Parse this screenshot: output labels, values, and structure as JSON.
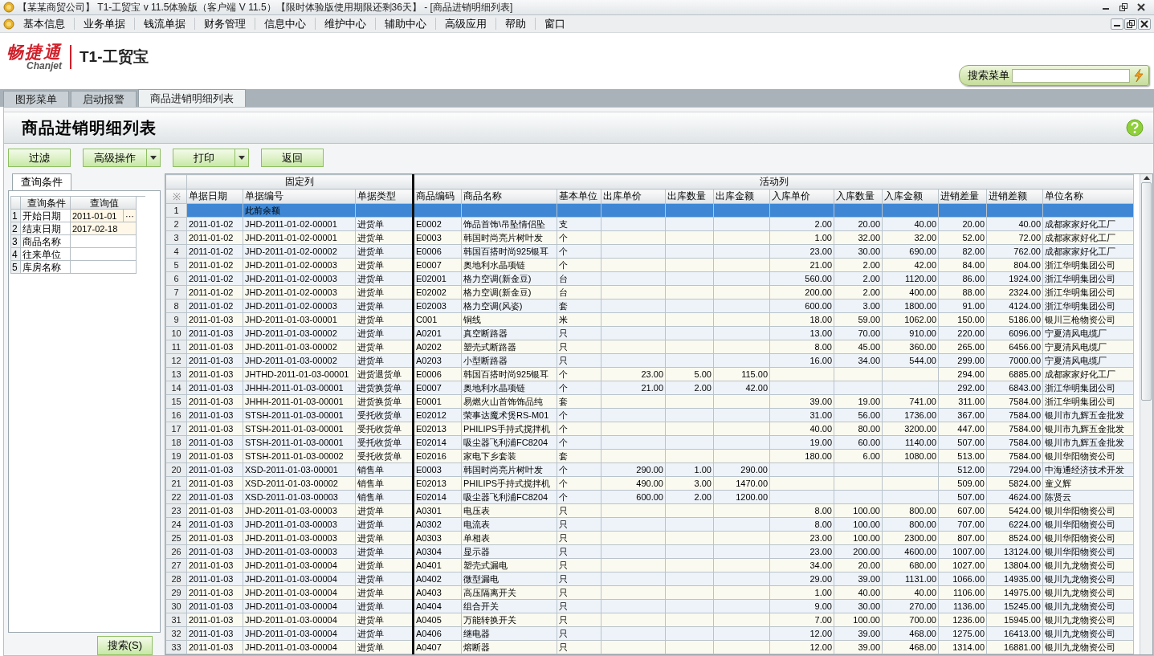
{
  "window": {
    "title": "【某某商贸公司】 T1-工贸宝 v 11.5体验版（客户端 V 11.5）【限时体验版使用期限还剩36天】 - [商品进销明细列表]"
  },
  "menu": [
    "基本信息",
    "业务单据",
    "钱流单据",
    "财务管理",
    "信息中心",
    "维护中心",
    "辅助中心",
    "高级应用",
    "帮助",
    "窗口"
  ],
  "logo": {
    "brand": "畅捷通",
    "brand_en": "Chanjet",
    "product": "T1-工贸宝"
  },
  "menu_search": {
    "label": "搜索菜单"
  },
  "tabs": [
    {
      "label": "图形菜单",
      "selected": false
    },
    {
      "label": "启动报警",
      "selected": false
    },
    {
      "label": "商品进销明细列表",
      "selected": true
    }
  ],
  "page_title": "商品进销明细列表",
  "toolbar": [
    {
      "label": "过滤",
      "dropdown": false
    },
    {
      "label": "高级操作",
      "dropdown": true
    },
    {
      "label": "打印",
      "dropdown": true
    },
    {
      "label": "返回",
      "dropdown": false
    }
  ],
  "query_panel": {
    "tab": "查询条件",
    "columns": [
      "查询条件",
      "查询值"
    ],
    "rows": [
      {
        "no": "1",
        "name": "开始日期",
        "value": "2011-01-01",
        "button": "···"
      },
      {
        "no": "2",
        "name": "结束日期",
        "value": "2017-02-18"
      },
      {
        "no": "3",
        "name": "商品名称"
      },
      {
        "no": "4",
        "name": "往来单位"
      },
      {
        "no": "5",
        "name": "库房名称"
      }
    ],
    "search_button": "搜索(S)"
  },
  "table": {
    "corner": "※",
    "groups": [
      {
        "label": "固定列",
        "columns": [
          "单据日期",
          "单据编号",
          "单据类型"
        ]
      },
      {
        "label": "活动列",
        "columns": [
          "商品编码",
          "商品名称",
          "基本单位",
          "出库单价",
          "出库数量",
          "出库金额",
          "入库单价",
          "入库数量",
          "入库金额",
          "进销差量",
          "进销差额",
          "单位名称"
        ]
      }
    ],
    "rows": [
      {
        "no": "1",
        "selected": true,
        "kind": "balance",
        "doc_no": "此前余额"
      },
      {
        "no": "2",
        "selected": false,
        "kind": "in",
        "date": "2011-01-02",
        "doc_no": "JHD-2011-01-02-00001",
        "doc_type": "进货单",
        "code": "E0002",
        "name": "饰品首饰\\吊坠情侣坠",
        "unit": "支",
        "price": "2.00",
        "qty": "20.00",
        "amount": "40.00",
        "diff_qty": "20.00",
        "diff_amount": "40.00",
        "partner": "成都家家好化工厂"
      },
      {
        "no": "3",
        "selected": false,
        "kind": "in",
        "date": "2011-01-02",
        "doc_no": "JHD-2011-01-02-00001",
        "doc_type": "进货单",
        "code": "E0003",
        "name": "韩国时尚亮片树叶发",
        "unit": "个",
        "price": "1.00",
        "qty": "32.00",
        "amount": "32.00",
        "diff_qty": "52.00",
        "diff_amount": "72.00",
        "partner": "成都家家好化工厂"
      },
      {
        "no": "4",
        "selected": false,
        "kind": "in",
        "date": "2011-01-02",
        "doc_no": "JHD-2011-01-02-00002",
        "doc_type": "进货单",
        "code": "E0006",
        "name": "韩国百搭时尚925银耳",
        "unit": "个",
        "price": "23.00",
        "qty": "30.00",
        "amount": "690.00",
        "diff_qty": "82.00",
        "diff_amount": "762.00",
        "partner": "成都家家好化工厂"
      },
      {
        "no": "5",
        "selected": false,
        "kind": "in",
        "date": "2011-01-02",
        "doc_no": "JHD-2011-01-02-00003",
        "doc_type": "进货单",
        "code": "E0007",
        "name": "奥地利水晶项链",
        "unit": "个",
        "price": "21.00",
        "qty": "2.00",
        "amount": "42.00",
        "diff_qty": "84.00",
        "diff_amount": "804.00",
        "partner": "浙江华明集团公司"
      },
      {
        "no": "6",
        "selected": false,
        "kind": "in",
        "date": "2011-01-02",
        "doc_no": "JHD-2011-01-02-00003",
        "doc_type": "进货单",
        "code": "E02001",
        "name": "格力空调(新金豆)",
        "unit": "台",
        "price": "560.00",
        "qty": "2.00",
        "amount": "1120.00",
        "diff_qty": "86.00",
        "diff_amount": "1924.00",
        "partner": "浙江华明集团公司"
      },
      {
        "no": "7",
        "selected": false,
        "kind": "in",
        "date": "2011-01-02",
        "doc_no": "JHD-2011-01-02-00003",
        "doc_type": "进货单",
        "code": "E02002",
        "name": "格力空调(新金豆)",
        "unit": "台",
        "price": "200.00",
        "qty": "2.00",
        "amount": "400.00",
        "diff_qty": "88.00",
        "diff_amount": "2324.00",
        "partner": "浙江华明集团公司"
      },
      {
        "no": "8",
        "selected": false,
        "kind": "in",
        "date": "2011-01-02",
        "doc_no": "JHD-2011-01-02-00003",
        "doc_type": "进货单",
        "code": "E02003",
        "name": "格力空调(风姿)",
        "unit": "套",
        "price": "600.00",
        "qty": "3.00",
        "amount": "1800.00",
        "diff_qty": "91.00",
        "diff_amount": "4124.00",
        "partner": "浙江华明集团公司"
      },
      {
        "no": "9",
        "selected": false,
        "kind": "in",
        "date": "2011-01-03",
        "doc_no": "JHD-2011-01-03-00001",
        "doc_type": "进货单",
        "code": "C001",
        "name": "铜线",
        "unit": "米",
        "price": "18.00",
        "qty": "59.00",
        "amount": "1062.00",
        "diff_qty": "150.00",
        "diff_amount": "5186.00",
        "partner": "银川三枪物资公司"
      },
      {
        "no": "10",
        "selected": false,
        "kind": "in",
        "date": "2011-01-03",
        "doc_no": "JHD-2011-01-03-00002",
        "doc_type": "进货单",
        "code": "A0201",
        "name": "真空断路器",
        "unit": "只",
        "price": "13.00",
        "qty": "70.00",
        "amount": "910.00",
        "diff_qty": "220.00",
        "diff_amount": "6096.00",
        "partner": "宁夏清风电缆厂"
      },
      {
        "no": "11",
        "selected": false,
        "kind": "in",
        "date": "2011-01-03",
        "doc_no": "JHD-2011-01-03-00002",
        "doc_type": "进货单",
        "code": "A0202",
        "name": "塑壳式断路器",
        "unit": "只",
        "price": "8.00",
        "qty": "45.00",
        "amount": "360.00",
        "diff_qty": "265.00",
        "diff_amount": "6456.00",
        "partner": "宁夏清风电缆厂"
      },
      {
        "no": "12",
        "selected": false,
        "kind": "in",
        "date": "2011-01-03",
        "doc_no": "JHD-2011-01-03-00002",
        "doc_type": "进货单",
        "code": "A0203",
        "name": "小型断路器",
        "unit": "只",
        "price": "16.00",
        "qty": "34.00",
        "amount": "544.00",
        "diff_qty": "299.00",
        "diff_amount": "7000.00",
        "partner": "宁夏清风电缆厂"
      },
      {
        "no": "13",
        "selected": false,
        "kind": "out",
        "date": "2011-01-03",
        "doc_no": "JHTHD-2011-01-03-00001",
        "doc_type": "进货退货单",
        "code": "E0006",
        "name": "韩国百搭时尚925银耳",
        "unit": "个",
        "price": "23.00",
        "qty": "5.00",
        "amount": "115.00",
        "diff_qty": "294.00",
        "diff_amount": "6885.00",
        "partner": "成都家家好化工厂"
      },
      {
        "no": "14",
        "selected": false,
        "kind": "out",
        "date": "2011-01-03",
        "doc_no": "JHHH-2011-01-03-00001",
        "doc_type": "进货换货单",
        "code": "E0007",
        "name": "奥地利水晶项链",
        "unit": "个",
        "price": "21.00",
        "qty": "2.00",
        "amount": "42.00",
        "diff_qty": "292.00",
        "diff_amount": "6843.00",
        "partner": "浙江华明集团公司"
      },
      {
        "no": "15",
        "selected": false,
        "kind": "in",
        "date": "2011-01-03",
        "doc_no": "JHHH-2011-01-03-00001",
        "doc_type": "进货换货单",
        "code": "E0001",
        "name": "易燃火山首饰饰品纯",
        "unit": "套",
        "price": "39.00",
        "qty": "19.00",
        "amount": "741.00",
        "diff_qty": "311.00",
        "diff_amount": "7584.00",
        "partner": "浙江华明集团公司"
      },
      {
        "no": "16",
        "selected": false,
        "kind": "in",
        "date": "2011-01-03",
        "doc_no": "STSH-2011-01-03-00001",
        "doc_type": "受托收货单",
        "code": "E02012",
        "name": "荣事达魔术煲RS-M01",
        "unit": "个",
        "price": "31.00",
        "qty": "56.00",
        "amount": "1736.00",
        "diff_qty": "367.00",
        "diff_amount": "7584.00",
        "partner": "银川市九辉五金批发"
      },
      {
        "no": "17",
        "selected": false,
        "kind": "in",
        "date": "2011-01-03",
        "doc_no": "STSH-2011-01-03-00001",
        "doc_type": "受托收货单",
        "code": "E02013",
        "name": "PHILIPS手持式搅拌机",
        "unit": "个",
        "price": "40.00",
        "qty": "80.00",
        "amount": "3200.00",
        "diff_qty": "447.00",
        "diff_amount": "7584.00",
        "partner": "银川市九辉五金批发"
      },
      {
        "no": "18",
        "selected": false,
        "kind": "in",
        "date": "2011-01-03",
        "doc_no": "STSH-2011-01-03-00001",
        "doc_type": "受托收货单",
        "code": "E02014",
        "name": "吸尘器飞利浦FC8204",
        "unit": "个",
        "price": "19.00",
        "qty": "60.00",
        "amount": "1140.00",
        "diff_qty": "507.00",
        "diff_amount": "7584.00",
        "partner": "银川市九辉五金批发"
      },
      {
        "no": "19",
        "selected": false,
        "kind": "in",
        "date": "2011-01-03",
        "doc_no": "STSH-2011-01-03-00002",
        "doc_type": "受托收货单",
        "code": "E02016",
        "name": "家电下乡套装",
        "unit": "套",
        "price": "180.00",
        "qty": "6.00",
        "amount": "1080.00",
        "diff_qty": "513.00",
        "diff_amount": "7584.00",
        "partner": "银川华阳物资公司"
      },
      {
        "no": "20",
        "selected": false,
        "kind": "out",
        "date": "2011-01-03",
        "doc_no": "XSD-2011-01-03-00001",
        "doc_type": "销售单",
        "code": "E0003",
        "name": "韩国时尚亮片树叶发",
        "unit": "个",
        "price": "290.00",
        "qty": "1.00",
        "amount": "290.00",
        "diff_qty": "512.00",
        "diff_amount": "7294.00",
        "partner": "中海通经济技术开发"
      },
      {
        "no": "21",
        "selected": false,
        "kind": "out",
        "date": "2011-01-03",
        "doc_no": "XSD-2011-01-03-00002",
        "doc_type": "销售单",
        "code": "E02013",
        "name": "PHILIPS手持式搅拌机",
        "unit": "个",
        "price": "490.00",
        "qty": "3.00",
        "amount": "1470.00",
        "diff_qty": "509.00",
        "diff_amount": "5824.00",
        "partner": "童义辉"
      },
      {
        "no": "22",
        "selected": false,
        "kind": "out",
        "date": "2011-01-03",
        "doc_no": "XSD-2011-01-03-00003",
        "doc_type": "销售单",
        "code": "E02014",
        "name": "吸尘器飞利浦FC8204",
        "unit": "个",
        "price": "600.00",
        "qty": "2.00",
        "amount": "1200.00",
        "diff_qty": "507.00",
        "diff_amount": "4624.00",
        "partner": "陈贤云"
      },
      {
        "no": "23",
        "selected": false,
        "kind": "in",
        "date": "2011-01-03",
        "doc_no": "JHD-2011-01-03-00003",
        "doc_type": "进货单",
        "code": "A0301",
        "name": "电压表",
        "unit": "只",
        "price": "8.00",
        "qty": "100.00",
        "amount": "800.00",
        "diff_qty": "607.00",
        "diff_amount": "5424.00",
        "partner": "银川华阳物资公司"
      },
      {
        "no": "24",
        "selected": false,
        "kind": "in",
        "date": "2011-01-03",
        "doc_no": "JHD-2011-01-03-00003",
        "doc_type": "进货单",
        "code": "A0302",
        "name": "电流表",
        "unit": "只",
        "price": "8.00",
        "qty": "100.00",
        "amount": "800.00",
        "diff_qty": "707.00",
        "diff_amount": "6224.00",
        "partner": "银川华阳物资公司"
      },
      {
        "no": "25",
        "selected": false,
        "kind": "in",
        "date": "2011-01-03",
        "doc_no": "JHD-2011-01-03-00003",
        "doc_type": "进货单",
        "code": "A0303",
        "name": "单相表",
        "unit": "只",
        "price": "23.00",
        "qty": "100.00",
        "amount": "2300.00",
        "diff_qty": "807.00",
        "diff_amount": "8524.00",
        "partner": "银川华阳物资公司"
      },
      {
        "no": "26",
        "selected": false,
        "kind": "in",
        "date": "2011-01-03",
        "doc_no": "JHD-2011-01-03-00003",
        "doc_type": "进货单",
        "code": "A0304",
        "name": "显示器",
        "unit": "只",
        "price": "23.00",
        "qty": "200.00",
        "amount": "4600.00",
        "diff_qty": "1007.00",
        "diff_amount": "13124.00",
        "partner": "银川华阳物资公司"
      },
      {
        "no": "27",
        "selected": false,
        "kind": "in",
        "date": "2011-01-03",
        "doc_no": "JHD-2011-01-03-00004",
        "doc_type": "进货单",
        "code": "A0401",
        "name": "塑壳式漏电",
        "unit": "只",
        "price": "34.00",
        "qty": "20.00",
        "amount": "680.00",
        "diff_qty": "1027.00",
        "diff_amount": "13804.00",
        "partner": "银川九龙物资公司"
      },
      {
        "no": "28",
        "selected": false,
        "kind": "in",
        "date": "2011-01-03",
        "doc_no": "JHD-2011-01-03-00004",
        "doc_type": "进货单",
        "code": "A0402",
        "name": "微型漏电",
        "unit": "只",
        "price": "29.00",
        "qty": "39.00",
        "amount": "1131.00",
        "diff_qty": "1066.00",
        "diff_amount": "14935.00",
        "partner": "银川九龙物资公司"
      },
      {
        "no": "29",
        "selected": false,
        "kind": "in",
        "date": "2011-01-03",
        "doc_no": "JHD-2011-01-03-00004",
        "doc_type": "进货单",
        "code": "A0403",
        "name": "高压隔离开关",
        "unit": "只",
        "price": "1.00",
        "qty": "40.00",
        "amount": "40.00",
        "diff_qty": "1106.00",
        "diff_amount": "14975.00",
        "partner": "银川九龙物资公司"
      },
      {
        "no": "30",
        "selected": false,
        "kind": "in",
        "date": "2011-01-03",
        "doc_no": "JHD-2011-01-03-00004",
        "doc_type": "进货单",
        "code": "A0404",
        "name": "组合开关",
        "unit": "只",
        "price": "9.00",
        "qty": "30.00",
        "amount": "270.00",
        "diff_qty": "1136.00",
        "diff_amount": "15245.00",
        "partner": "银川九龙物资公司"
      },
      {
        "no": "31",
        "selected": false,
        "kind": "in",
        "date": "2011-01-03",
        "doc_no": "JHD-2011-01-03-00004",
        "doc_type": "进货单",
        "code": "A0405",
        "name": "万能转换开关",
        "unit": "只",
        "price": "7.00",
        "qty": "100.00",
        "amount": "700.00",
        "diff_qty": "1236.00",
        "diff_amount": "15945.00",
        "partner": "银川九龙物资公司"
      },
      {
        "no": "32",
        "selected": false,
        "kind": "in",
        "date": "2011-01-03",
        "doc_no": "JHD-2011-01-03-00004",
        "doc_type": "进货单",
        "code": "A0406",
        "name": "继电器",
        "unit": "只",
        "price": "12.00",
        "qty": "39.00",
        "amount": "468.00",
        "diff_qty": "1275.00",
        "diff_amount": "16413.00",
        "partner": "银川九龙物资公司"
      },
      {
        "no": "33",
        "selected": false,
        "kind": "in",
        "date": "2011-01-03",
        "doc_no": "JHD-2011-01-03-00004",
        "doc_type": "进货单",
        "code": "A0407",
        "name": "熔断器",
        "unit": "只",
        "price": "12.00",
        "qty": "39.00",
        "amount": "468.00",
        "diff_qty": "1314.00",
        "diff_amount": "16881.00",
        "partner": "银川九龙物资公司"
      }
    ]
  }
}
